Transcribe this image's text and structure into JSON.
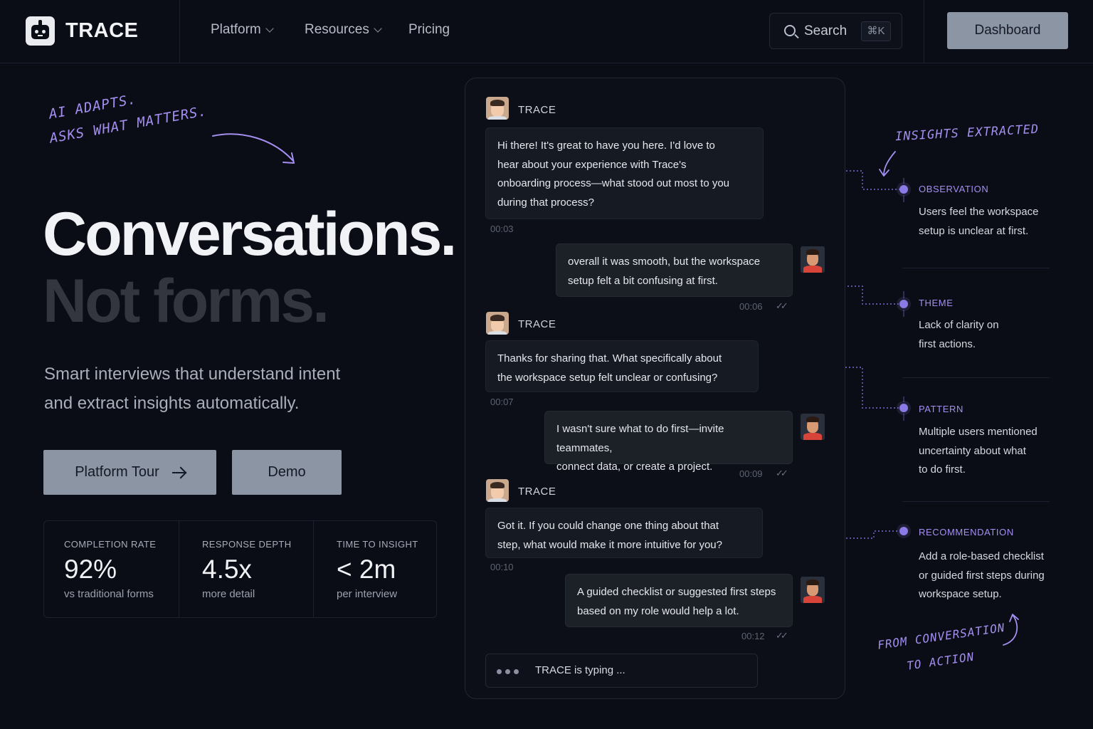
{
  "brand": {
    "name": "TRACE"
  },
  "nav": {
    "links": [
      {
        "label": "Platform",
        "has_menu": true
      },
      {
        "label": "Resources",
        "has_menu": true
      },
      {
        "label": "Pricing",
        "has_menu": false
      }
    ],
    "search": {
      "label": "Search",
      "shortcut": "⌘K"
    },
    "dashboard_label": "Dashboard"
  },
  "hero": {
    "annotation_line1": "AI ADAPTS.",
    "annotation_line2": "ASKS WHAT MATTERS.",
    "headline_line1": "Conversations.",
    "headline_line2": "Not forms.",
    "subtitle_line1": "Smart interviews that understand intent",
    "subtitle_line2": "and extract insights automatically.",
    "primary_button": "Platform Tour",
    "secondary_button": "Demo"
  },
  "stats": [
    {
      "label": "COMPLETION RATE",
      "value": "92%",
      "note": "vs traditional forms"
    },
    {
      "label": "RESPONSE DEPTH",
      "value": "4.5x",
      "note": "more detail"
    },
    {
      "label": "TIME TO INSIGHT",
      "value": "< 2m",
      "note": "per interview"
    }
  ],
  "chat": {
    "bot_name": "TRACE",
    "messages": [
      {
        "from": "bot",
        "lines": [
          "Hi there! It's great to have you here. I'd love to",
          "hear about your experience with Trace's",
          "onboarding process—what stood out most to you",
          "during that process?"
        ],
        "time": "00:03"
      },
      {
        "from": "user",
        "lines": [
          "overall it was smooth, but the workspace",
          "setup felt a bit confusing at first."
        ],
        "time": "00:06"
      },
      {
        "from": "bot",
        "lines": [
          "Thanks for sharing that. What specifically about",
          "the workspace setup felt unclear or confusing?"
        ],
        "time": "00:07"
      },
      {
        "from": "user",
        "lines": [
          "I wasn't sure what to do first—invite teammates,",
          "connect data, or create a project."
        ],
        "time": "00:09"
      },
      {
        "from": "bot",
        "lines": [
          "Got it. If you could change one thing about that",
          "step, what would make it more intuitive for you?"
        ],
        "time": "00:10"
      },
      {
        "from": "user",
        "lines": [
          "A guided checklist or suggested first steps",
          "based on my role would help a lot."
        ],
        "time": "00:12"
      }
    ],
    "read_ticks": "✓✓",
    "typing_text": "TRACE is typing ..."
  },
  "insights": {
    "heading": "INSIGHTS EXTRACTED",
    "items": [
      {
        "title": "OBSERVATION",
        "lines": [
          "Users feel the workspace",
          "setup is unclear at first."
        ]
      },
      {
        "title": "THEME",
        "lines": [
          "Lack of clarity on",
          "first actions."
        ]
      },
      {
        "title": "PATTERN",
        "lines": [
          "Multiple users mentioned",
          "uncertainty about what",
          "to do first."
        ]
      },
      {
        "title": "RECOMMENDATION",
        "lines": [
          "Add a role-based checklist",
          "or guided first steps during",
          "workspace setup."
        ]
      }
    ],
    "footer_line1": "FROM CONVERSATION",
    "footer_line2": "TO ACTION"
  },
  "colors": {
    "accent": "#a48ff0",
    "button": "#8b95a4",
    "background": "#0a0d15"
  }
}
